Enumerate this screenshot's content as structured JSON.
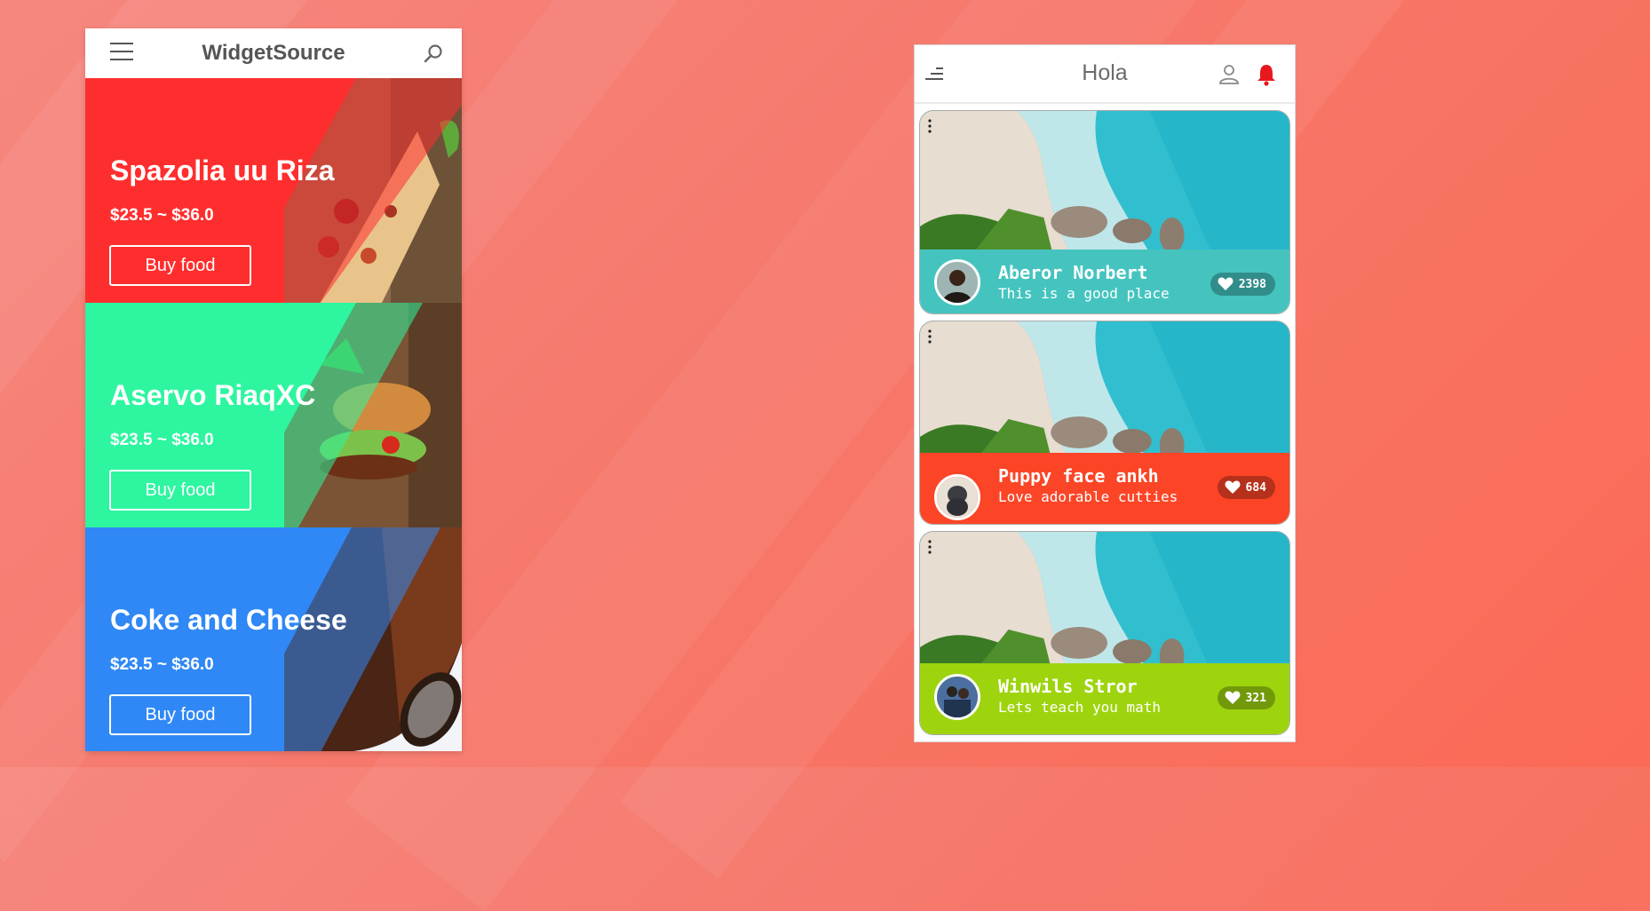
{
  "left_app": {
    "title": "WidgetSource",
    "cards": [
      {
        "name": "Spazolia uu Riza",
        "price": "$23.5 ~ $36.0",
        "button": "Buy food",
        "color": "#ff2e2e"
      },
      {
        "name": "Aservo RiaqXC",
        "price": "$23.5 ~ $36.0",
        "button": "Buy food",
        "color": "#2ef5a0"
      },
      {
        "name": "Coke and Cheese",
        "price": "$23.5 ~ $36.0",
        "button": "Buy food",
        "color": "#2f88f5"
      }
    ]
  },
  "right_app": {
    "title": "Hola",
    "posts": [
      {
        "name": "Aberor Norbert",
        "description": "This is a good place",
        "likes": "2398",
        "color": "#45c4bf"
      },
      {
        "name": "Puppy face ankh",
        "description": "Love adorable cutties",
        "likes": "684",
        "color": "#fb4526"
      },
      {
        "name": "Winwils Stror",
        "description": "Lets teach you math",
        "likes": "321",
        "color": "#9ed40e"
      }
    ]
  },
  "icons": {
    "left_header": [
      "menu-icon",
      "search-icon"
    ],
    "right_header": [
      "sort-icon",
      "user-icon",
      "bell-icon"
    ],
    "post": [
      "more-icon",
      "heart-icon",
      "avatar"
    ]
  }
}
